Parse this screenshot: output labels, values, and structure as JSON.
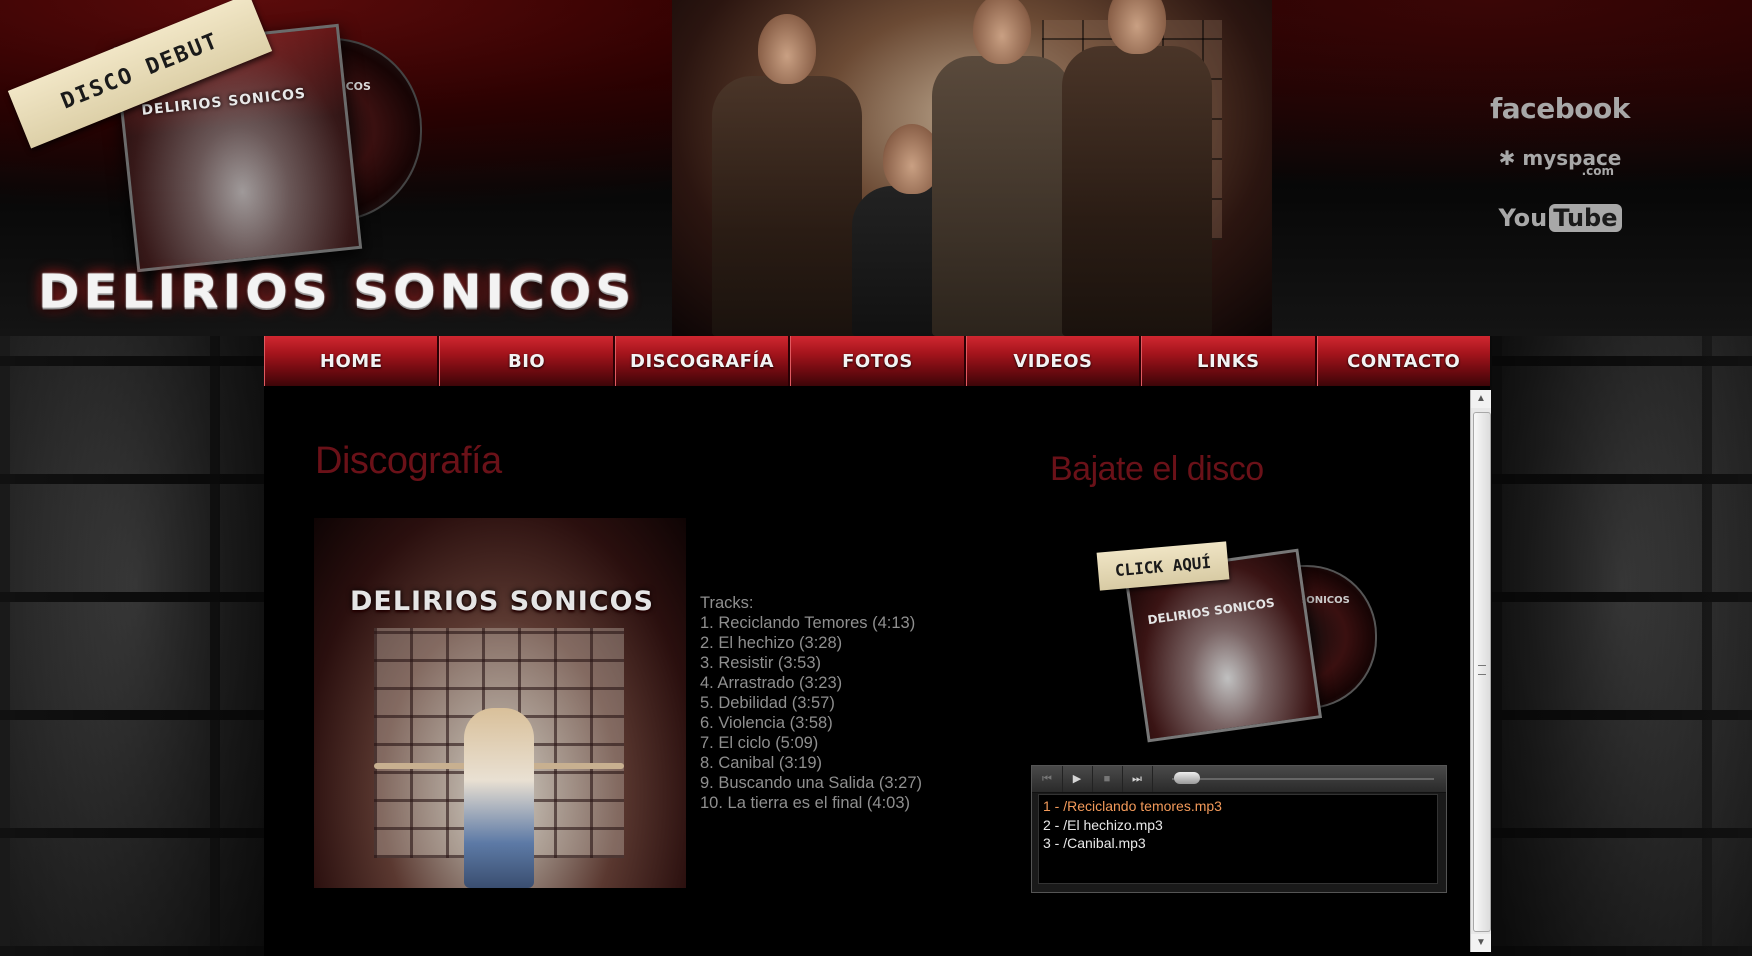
{
  "header": {
    "site_title": "DELIRIOS SONICOS",
    "tape_label": "DISCO DEBUT",
    "cd_title": "DELIRIOS SONICOS",
    "disc_title": "SONICOS"
  },
  "social": {
    "facebook": "facebook",
    "myspace": "myspace",
    "myspace_com": ".com",
    "youtube_you": "You",
    "youtube_tube": "Tube"
  },
  "nav": {
    "items": [
      {
        "label": "HOME"
      },
      {
        "label": "BIO"
      },
      {
        "label": "DISCOGRAFÍA"
      },
      {
        "label": "FOTOS"
      },
      {
        "label": "VIDEOS"
      },
      {
        "label": "LINKS"
      },
      {
        "label": "CONTACTO"
      }
    ]
  },
  "main": {
    "title": "Discografía",
    "album_title": "DELIRIOS SONICOS",
    "tracks_heading": "Tracks:",
    "tracks": [
      "1. Reciclando Temores (4:13)",
      "2. El hechizo (3:28)",
      "3. Resistir (3:53)",
      "4. Arrastrado (3:23)",
      "5. Debilidad (3:57)",
      "6. Violencia (3:58)",
      "7. El ciclo (5:09)",
      "8. Canibal (3:19)",
      "9. Buscando una Salida (3:27)",
      "10. La tierra es el final (4:03)"
    ]
  },
  "download": {
    "title": "Bajate el disco",
    "click_label": "CLICK AQUÍ",
    "cd_title": "DELIRIOS SONICOS",
    "disc_title": "SONICOS"
  },
  "player": {
    "prev_icon": "⏮",
    "play_icon": "▶",
    "stop_icon": "■",
    "next_icon": "⏭",
    "playlist": [
      "1 - /Reciclando temores.mp3",
      "2 - /El hechizo.mp3",
      "3 - /Canibal.mp3"
    ],
    "active_index": 0
  },
  "scrollbar": {
    "up_icon": "▲",
    "down_icon": "▼"
  },
  "colors": {
    "nav_red": "#a4141c",
    "title_red": "#6a1118",
    "track_gray": "#8f8f8f",
    "active_track": "#f39a5a"
  }
}
